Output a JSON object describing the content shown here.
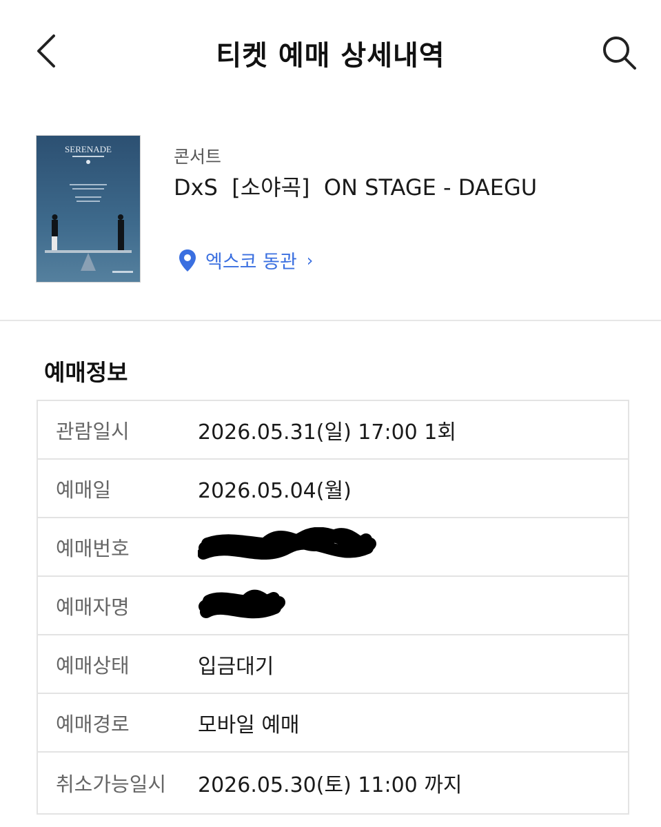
{
  "header": {
    "title": "티켓 예매 상세내역",
    "back_icon": "chevron-left-icon",
    "search_icon": "search-icon"
  },
  "event": {
    "category": "콘서트",
    "title": "DxS  [소야곡]  ON STAGE - DAEGU",
    "poster_text": "SERENADE",
    "venue": "엑스코 동관",
    "venue_icon": "map-pin-icon",
    "venue_chevron": "›",
    "accent_color": "#3a6fe0"
  },
  "booking_info": {
    "section_title": "예매정보",
    "rows": [
      {
        "label": "관람일시",
        "value": "2026.05.31(일) 17:00 1회"
      },
      {
        "label": "예매일",
        "value": "2026.05.04(월)"
      },
      {
        "label": "예매번호",
        "value": "",
        "redacted": true
      },
      {
        "label": "예매자명",
        "value": "",
        "redacted": true
      },
      {
        "label": "예매상태",
        "value": "입금대기"
      },
      {
        "label": "예매경로",
        "value": "모바일 예매"
      },
      {
        "label": "취소가능일시",
        "value": "2026.05.30(토) 11:00 까지"
      }
    ]
  }
}
